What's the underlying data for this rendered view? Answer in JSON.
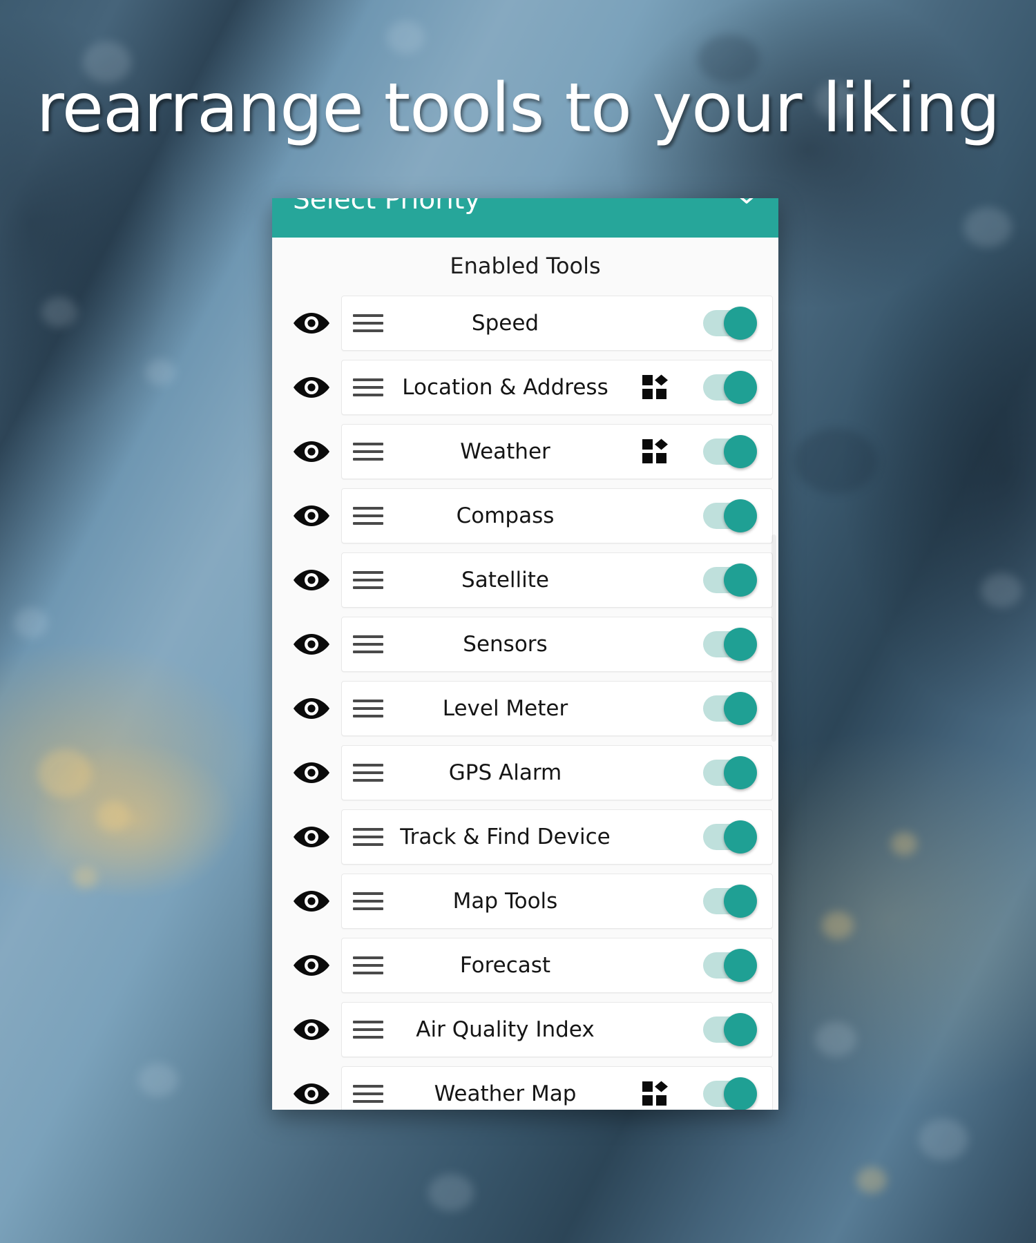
{
  "caption": {
    "text": "rearrange tools to your liking"
  },
  "colors": {
    "accent_teal": "#26a69a",
    "toggle_thumb": "#1fa094",
    "toggle_track": "#bfe0dc",
    "card_background": "#ffffff",
    "list_background": "#fafafa"
  },
  "dialog": {
    "appbar": {
      "title": "Select Priority",
      "chevron_icon": "chevron-down-icon",
      "chevron_glyph": "⌄"
    },
    "section_title": "Enabled Tools",
    "tools": [
      {
        "label": "Speed",
        "visibility_icon": "eye-icon",
        "drag_icon": "drag-handle-icon",
        "widget_icon": null,
        "enabled": true
      },
      {
        "label": "Location & Address",
        "visibility_icon": "eye-icon",
        "drag_icon": "drag-handle-icon",
        "widget_icon": "widgets-icon",
        "enabled": true
      },
      {
        "label": "Weather",
        "visibility_icon": "eye-icon",
        "drag_icon": "drag-handle-icon",
        "widget_icon": "widgets-icon",
        "enabled": true
      },
      {
        "label": "Compass",
        "visibility_icon": "eye-icon",
        "drag_icon": "drag-handle-icon",
        "widget_icon": null,
        "enabled": true
      },
      {
        "label": "Satellite",
        "visibility_icon": "eye-icon",
        "drag_icon": "drag-handle-icon",
        "widget_icon": null,
        "enabled": true
      },
      {
        "label": "Sensors",
        "visibility_icon": "eye-icon",
        "drag_icon": "drag-handle-icon",
        "widget_icon": null,
        "enabled": true
      },
      {
        "label": "Level Meter",
        "visibility_icon": "eye-icon",
        "drag_icon": "drag-handle-icon",
        "widget_icon": null,
        "enabled": true
      },
      {
        "label": "GPS Alarm",
        "visibility_icon": "eye-icon",
        "drag_icon": "drag-handle-icon",
        "widget_icon": null,
        "enabled": true
      },
      {
        "label": "Track & Find Device",
        "visibility_icon": "eye-icon",
        "drag_icon": "drag-handle-icon",
        "widget_icon": null,
        "enabled": true
      },
      {
        "label": "Map Tools",
        "visibility_icon": "eye-icon",
        "drag_icon": "drag-handle-icon",
        "widget_icon": null,
        "enabled": true
      },
      {
        "label": "Forecast",
        "visibility_icon": "eye-icon",
        "drag_icon": "drag-handle-icon",
        "widget_icon": null,
        "enabled": true
      },
      {
        "label": "Air Quality Index",
        "visibility_icon": "eye-icon",
        "drag_icon": "drag-handle-icon",
        "widget_icon": null,
        "enabled": true
      },
      {
        "label": "Weather Map",
        "visibility_icon": "eye-icon",
        "drag_icon": "drag-handle-icon",
        "widget_icon": "widgets-icon",
        "enabled": true
      }
    ]
  }
}
